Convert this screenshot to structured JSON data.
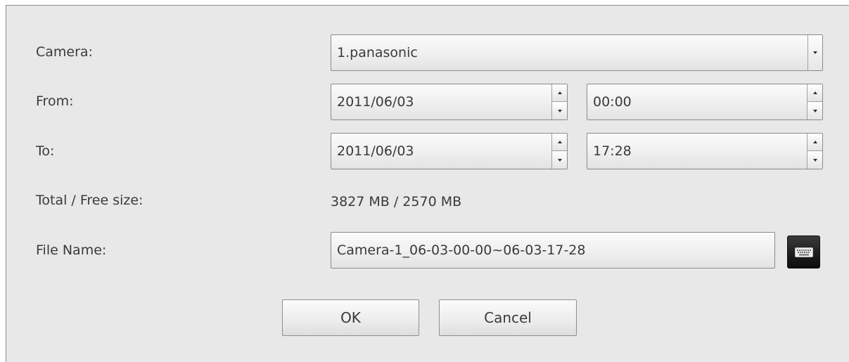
{
  "form": {
    "camera_label": "Camera:",
    "from_label": "From:",
    "to_label": "To:",
    "size_label": "Total / Free size:",
    "filename_label": "File Name:"
  },
  "fields": {
    "camera_value": "1.panasonic",
    "from_date": "2011/06/03",
    "from_time": "00:00",
    "to_date": "2011/06/03",
    "to_time": "17:28",
    "size_value": "3827 MB / 2570 MB",
    "filename_value": "Camera-1_06-03-00-00~06-03-17-28"
  },
  "buttons": {
    "ok_label": "OK",
    "cancel_label": "Cancel"
  },
  "icons": {
    "dropdown": "chevron-down-icon",
    "spin_up": "spin-up-icon",
    "spin_down": "spin-down-icon",
    "keyboard": "keyboard-icon"
  }
}
